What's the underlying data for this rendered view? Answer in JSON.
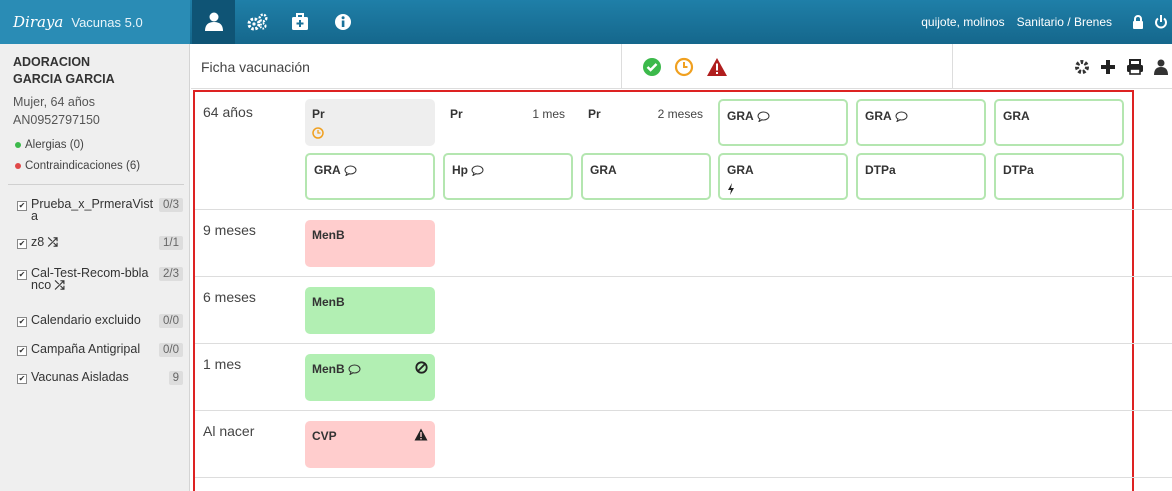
{
  "app": {
    "logo": "Diraya",
    "version": "Vacunas 5.0"
  },
  "topnav": [
    {
      "icon": "user-icon",
      "active": true
    },
    {
      "icon": "cogs-icon",
      "active": false
    },
    {
      "icon": "medkit-icon",
      "active": false
    },
    {
      "icon": "info-icon",
      "active": false
    }
  ],
  "session": {
    "user": "quijote, molinos",
    "role": "Sanitario / Brenes"
  },
  "patient": {
    "name_line1": "ADORACION",
    "name_line2": "GARCIA GARCIA",
    "sex_age": "Mujer, 64 años",
    "id": "AN0952797150",
    "alergias": "Alergias (0)",
    "contraindicaciones": "Contraindicaciones (6)"
  },
  "calendars": [
    {
      "label": "Prueba_x_PrmeraVista",
      "count": "0/3",
      "shuffle": false
    },
    {
      "label": "z8",
      "count": "1/1",
      "shuffle": true
    },
    {
      "label": "Cal-Test-Recom-bblanco",
      "count": "2/3",
      "shuffle": true
    },
    {
      "label": "Calendario excluido",
      "count": "0/0",
      "shuffle": false
    },
    {
      "label": "Campaña Antigripal",
      "count": "0/0",
      "shuffle": false
    },
    {
      "label": "Vacunas Aisladas",
      "count": "9",
      "shuffle": false
    }
  ],
  "toolbar": {
    "title": "Ficha vacunación"
  },
  "colors": {
    "topbar": "#1a729a",
    "pink": "#ffcdcd",
    "green": "#b2efb3",
    "outline": "#b4e6b0",
    "highlight": "#dd2222"
  },
  "rows": [
    {
      "label": "64 años"
    },
    {
      "label": "9 meses"
    },
    {
      "label": "6 meses"
    },
    {
      "label": "1 mes"
    },
    {
      "label": "Al nacer"
    }
  ],
  "cards": {
    "r0": [
      {
        "name": "Pr",
        "interval": "",
        "comment": false
      },
      {
        "name": "Pr",
        "interval": "1 mes",
        "comment": false
      },
      {
        "name": "Pr",
        "interval": "2 meses",
        "comment": false
      },
      {
        "name": "GRA",
        "interval": "",
        "comment": true
      },
      {
        "name": "GRA",
        "interval": "",
        "comment": true
      },
      {
        "name": "GRA",
        "interval": "",
        "comment": false
      },
      {
        "name": "GRA",
        "interval": "",
        "comment": true
      },
      {
        "name": "Hp",
        "interval": "",
        "comment": true
      },
      {
        "name": "GRA",
        "interval": "",
        "comment": false
      },
      {
        "name": "GRA",
        "interval": "",
        "comment": false
      },
      {
        "name": "DTPa",
        "interval": "",
        "comment": false
      },
      {
        "name": "DTPa",
        "interval": "",
        "comment": false
      }
    ],
    "r1": [
      {
        "name": "MenB"
      }
    ],
    "r2": [
      {
        "name": "MenB"
      }
    ],
    "r3": [
      {
        "name": "MenB",
        "comment": true
      }
    ],
    "r4": [
      {
        "name": "CVP"
      }
    ]
  }
}
